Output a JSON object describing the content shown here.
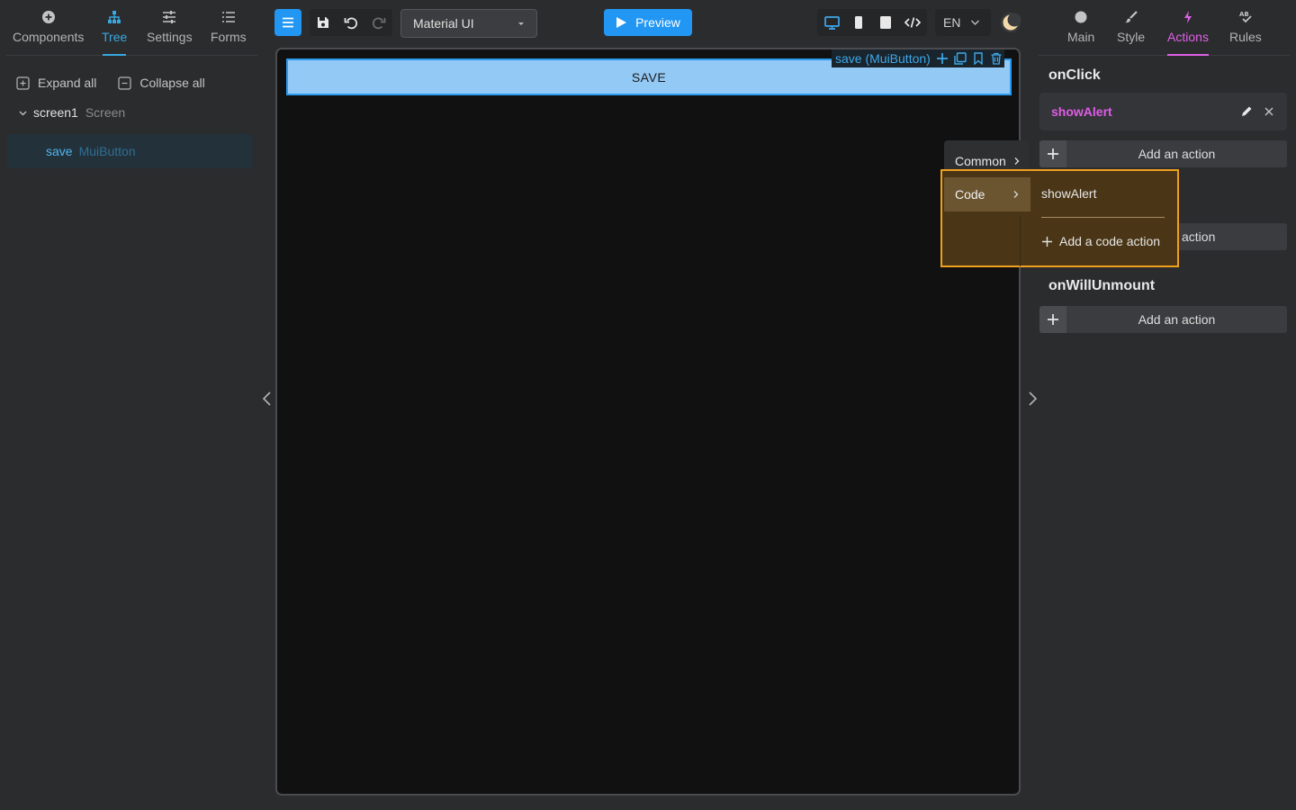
{
  "left_panel": {
    "tabs": [
      {
        "label": "Components",
        "icon": "plus-circle-icon"
      },
      {
        "label": "Tree",
        "icon": "tree-icon"
      },
      {
        "label": "Settings",
        "icon": "sliders-icon"
      },
      {
        "label": "Forms",
        "icon": "list-icon"
      }
    ],
    "active_tab": "Tree",
    "expand_all": "Expand all",
    "collapse_all": "Collapse all",
    "tree": {
      "screen": {
        "name": "screen1",
        "type": "Screen"
      },
      "selected": {
        "name": "save",
        "type": "MuiButton"
      }
    }
  },
  "toolbar": {
    "library": "Material UI",
    "preview": "Preview",
    "language": "EN"
  },
  "canvas": {
    "button_text": "SAVE",
    "component_label": "save (MuiButton)"
  },
  "context_menu": {
    "common": "Common",
    "code": "Code",
    "code_items": [
      "showAlert"
    ],
    "add_code_action": "Add a code action"
  },
  "right_panel": {
    "tabs": [
      {
        "label": "Main",
        "icon": "circle-icon"
      },
      {
        "label": "Style",
        "icon": "brush-icon"
      },
      {
        "label": "Actions",
        "icon": "lightning-icon"
      },
      {
        "label": "Rules",
        "icon": "rules-icon"
      }
    ],
    "active_tab": "Actions",
    "events": [
      {
        "name": "onClick",
        "actions": [
          "showAlert"
        ],
        "add_label": "Add an action"
      },
      {
        "name": "",
        "partial_label": "action"
      },
      {
        "name": "onWillUnmount",
        "actions": [],
        "add_label": "Add an action"
      }
    ]
  },
  "colors": {
    "accent_blue": "#2196f3",
    "tree_accent": "#38a8e0",
    "actions_accent": "#e060e8",
    "highlight": "#f0a01e",
    "save_button_bg": "#93c9f5"
  }
}
